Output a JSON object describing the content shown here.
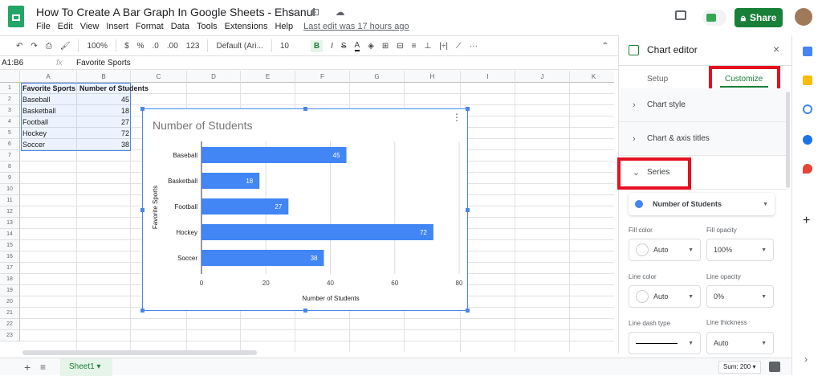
{
  "header": {
    "title": "How To Create A Bar Graph In Google Sheets - Ehsanul",
    "menu": [
      "File",
      "Edit",
      "View",
      "Insert",
      "Format",
      "Data",
      "Tools",
      "Extensions",
      "Help"
    ],
    "last_edit": "Last edit was 17 hours ago",
    "share_label": "Share",
    "header_icons": "☆ ⊡ ☁"
  },
  "toolbar": {
    "zoom": "100%",
    "currency": "$",
    "percent": "%",
    "dec_less": ".0",
    "dec_more": ".00",
    "format": "123",
    "font": "Default (Ari...",
    "font_size": "10",
    "bold": "B",
    "italic": "I",
    "strike": "S",
    "textcolor": "A",
    "more": "···"
  },
  "formula_bar": {
    "range": "A1:B6",
    "fx": "fx",
    "value": "Favorite Sports"
  },
  "columns": [
    "A",
    "B",
    "C",
    "D",
    "E",
    "F",
    "G",
    "H",
    "I",
    "J",
    "K"
  ],
  "rows": [
    "1",
    "2",
    "3",
    "4",
    "5",
    "6",
    "7",
    "8",
    "9",
    "10",
    "11",
    "12",
    "13",
    "14",
    "15",
    "16",
    "17",
    "18",
    "19",
    "20",
    "21",
    "22",
    "23"
  ],
  "table": {
    "headers": [
      "Favorite Sports",
      "Number of Students"
    ],
    "rows": [
      [
        "Baseball",
        "45"
      ],
      [
        "Basketball",
        "18"
      ],
      [
        "Football",
        "27"
      ],
      [
        "Hockey",
        "72"
      ],
      [
        "Soccer",
        "38"
      ]
    ]
  },
  "chart_data": {
    "type": "bar",
    "orientation": "horizontal",
    "title": "Number of Students",
    "xlabel": "Number of Students",
    "ylabel": "Favorite Sports",
    "categories": [
      "Baseball",
      "Basketball",
      "Football",
      "Hockey",
      "Soccer"
    ],
    "values": [
      45,
      18,
      27,
      72,
      38
    ],
    "xlim": [
      0,
      80
    ],
    "ticks": [
      "0",
      "20",
      "40",
      "60",
      "80"
    ],
    "color": "#4285f4",
    "grid": true,
    "data_labels": true
  },
  "editor": {
    "title": "Chart editor",
    "tabs": [
      "Setup",
      "Customize"
    ],
    "sections": [
      "Chart style",
      "Chart & axis titles",
      "Series"
    ],
    "series_select": "Number of Students",
    "series_color": "#4285f4",
    "fields": [
      {
        "label": "Fill color",
        "value": "Auto"
      },
      {
        "label": "Fill opacity",
        "value": "100%"
      },
      {
        "label": "Line color",
        "value": "Auto"
      },
      {
        "label": "Line opacity",
        "value": "0%"
      },
      {
        "label": "Line dash type",
        "value": ""
      },
      {
        "label": "Line thickness",
        "value": "Auto"
      }
    ]
  },
  "bottom": {
    "add": "+",
    "sheet": "Sheet1",
    "sum": "Sum: 200"
  },
  "colors": {
    "accent": "#188038",
    "highlight": "#e5101f"
  }
}
